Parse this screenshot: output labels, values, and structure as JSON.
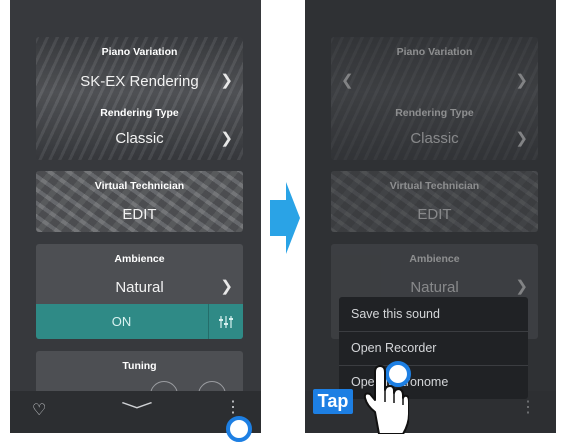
{
  "left_screen": {
    "piano_variation": {
      "title": "Piano Variation",
      "value": "SK-EX Rendering"
    },
    "rendering_type": {
      "title": "Rendering Type",
      "value": "Classic"
    },
    "virtual_technician": {
      "title": "Virtual Technician",
      "value": "EDIT"
    },
    "ambience": {
      "title": "Ambience",
      "value": "Natural",
      "toggle": "ON"
    },
    "tuning": {
      "title": "Tuning"
    }
  },
  "right_screen": {
    "piano_variation": {
      "title": "Piano Variation"
    },
    "rendering_type": {
      "title": "Rendering Type",
      "value": "Classic"
    },
    "virtual_technician": {
      "title": "Virtual Technician",
      "value": "EDIT"
    },
    "ambience": {
      "title": "Ambience",
      "value": "Natural"
    },
    "popup_menu": [
      "Save this sound",
      "Open Recorder",
      "Open Metronome"
    ]
  },
  "annotation": {
    "tap_label": "Tap"
  },
  "colors": {
    "accent_teal": "#2f8a86",
    "tap_blue": "#1d7fe3"
  },
  "icons": [
    "heart-icon",
    "chevron-down-icon",
    "more-vertical-icon",
    "chevron-right-icon",
    "equalizer-icon",
    "hand-pointer-icon",
    "arrow-right-icon"
  ]
}
